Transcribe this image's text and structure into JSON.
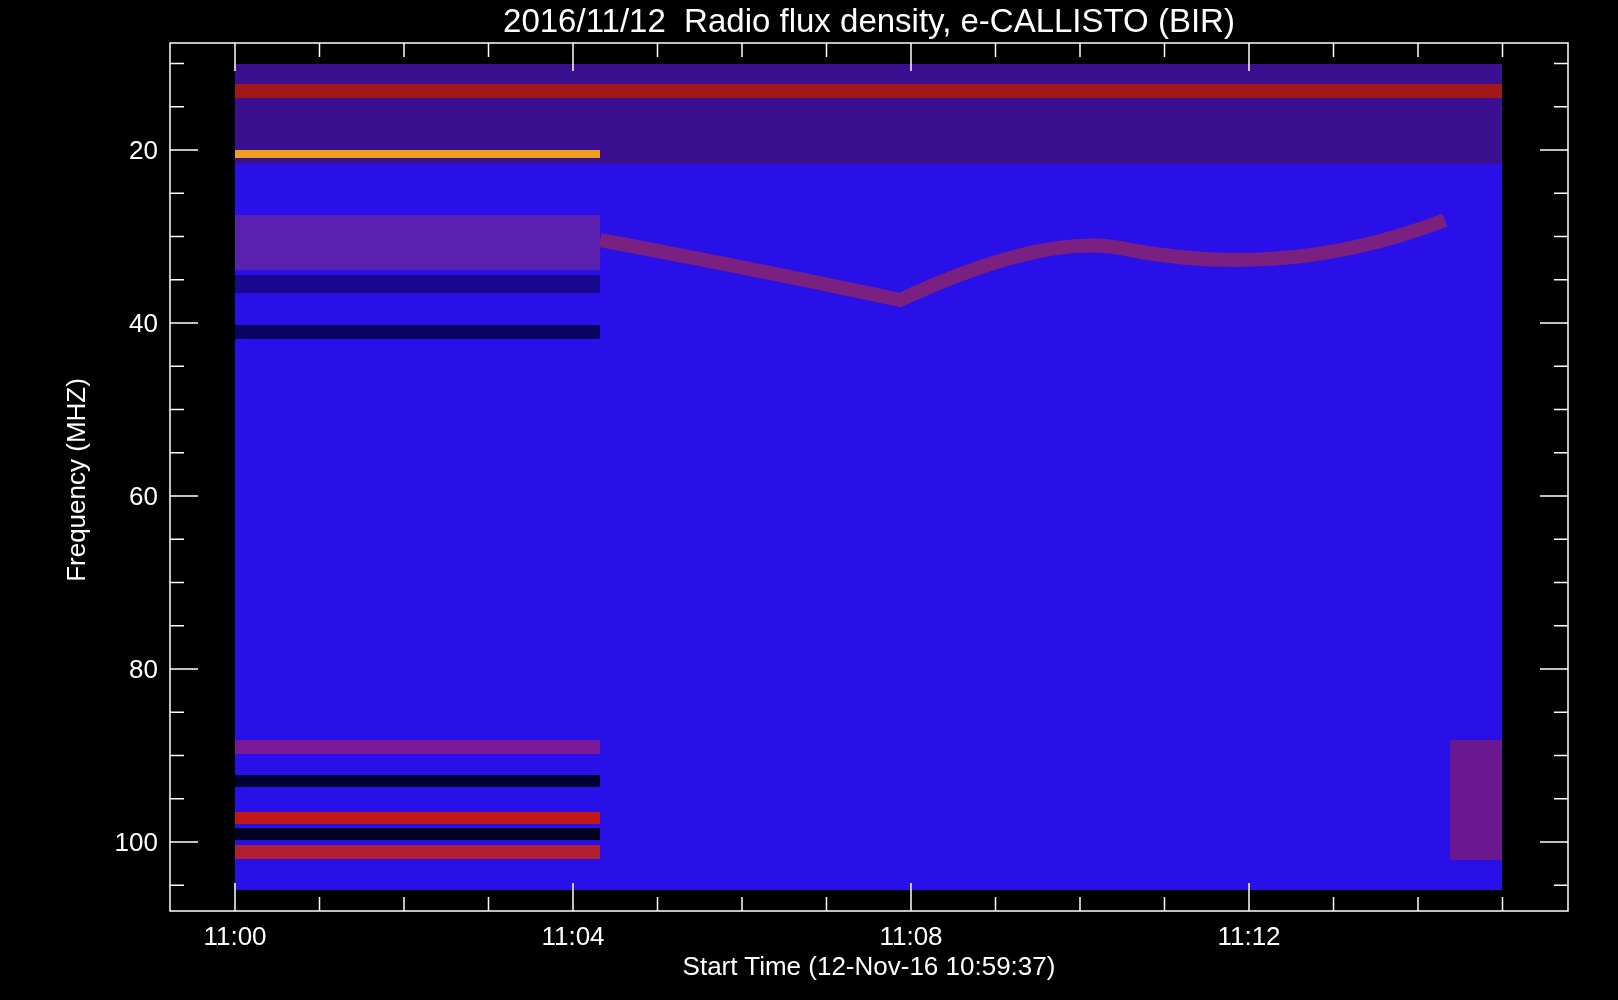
{
  "title": "2016/11/12  Radio flux density, e-CALLISTO (BIR)",
  "y_axis": {
    "label": "Frequency (MHZ)",
    "ticks": [
      "20",
      "40",
      "60",
      "80",
      "100"
    ]
  },
  "x_axis": {
    "label": "Start Time (12-Nov-16 10:59:37)",
    "ticks": [
      "11:00",
      "11:04",
      "11:08",
      "11:12"
    ]
  }
}
